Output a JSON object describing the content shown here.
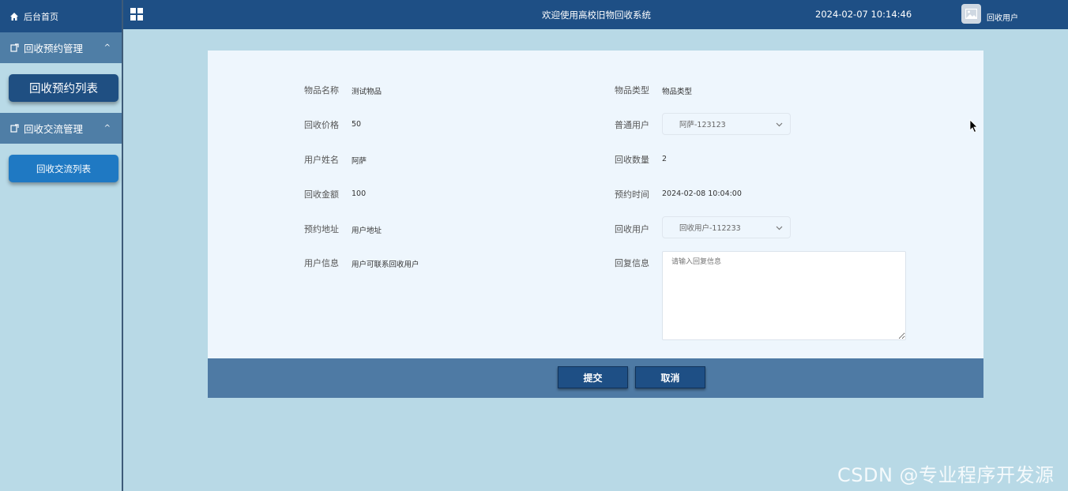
{
  "sidebar": {
    "home_label": "后台首页",
    "groups": [
      {
        "label": "回收预约管理",
        "items": [
          {
            "label": "回收预约列表"
          }
        ]
      },
      {
        "label": "回收交流管理",
        "items": [
          {
            "label": "回收交流列表"
          }
        ]
      }
    ]
  },
  "header": {
    "title": "欢迎使用高校旧物回收系统",
    "datetime": "2024-02-07 10:14:46",
    "user": "回收用户"
  },
  "form": {
    "item_name": {
      "label": "物品名称",
      "value": "测试物品"
    },
    "item_type": {
      "label": "物品类型",
      "value": "物品类型"
    },
    "price": {
      "label": "回收价格",
      "value": "50"
    },
    "normal_user": {
      "label": "普通用户",
      "value": "阿萨-123123"
    },
    "user_name": {
      "label": "用户姓名",
      "value": "阿萨"
    },
    "quantity": {
      "label": "回收数量",
      "value": "2"
    },
    "amount": {
      "label": "回收金额",
      "value": "100"
    },
    "appointment_time": {
      "label": "预约时间",
      "value": "2024-02-08 10:04:00"
    },
    "address": {
      "label": "预约地址",
      "value": "用户地址"
    },
    "recycle_user": {
      "label": "回收用户",
      "value": "回收用户-112233"
    },
    "user_info": {
      "label": "用户信息",
      "value": "用户可联系回收用户"
    },
    "reply": {
      "label": "回复信息",
      "placeholder": "请输入回复信息"
    }
  },
  "actions": {
    "submit": "提交",
    "cancel": "取消"
  },
  "watermark": "CSDN @专业程序开发源",
  "colors": {
    "header_bg": "#1e4f85",
    "menu_group_bg": "#4f7ea6",
    "active_item_bg": "#1f4f82",
    "item_bg": "#1f79c3",
    "page_bg": "#b8d9e6",
    "panel_bg": "#eef6fd",
    "footer_bg": "#4e7aa4"
  }
}
